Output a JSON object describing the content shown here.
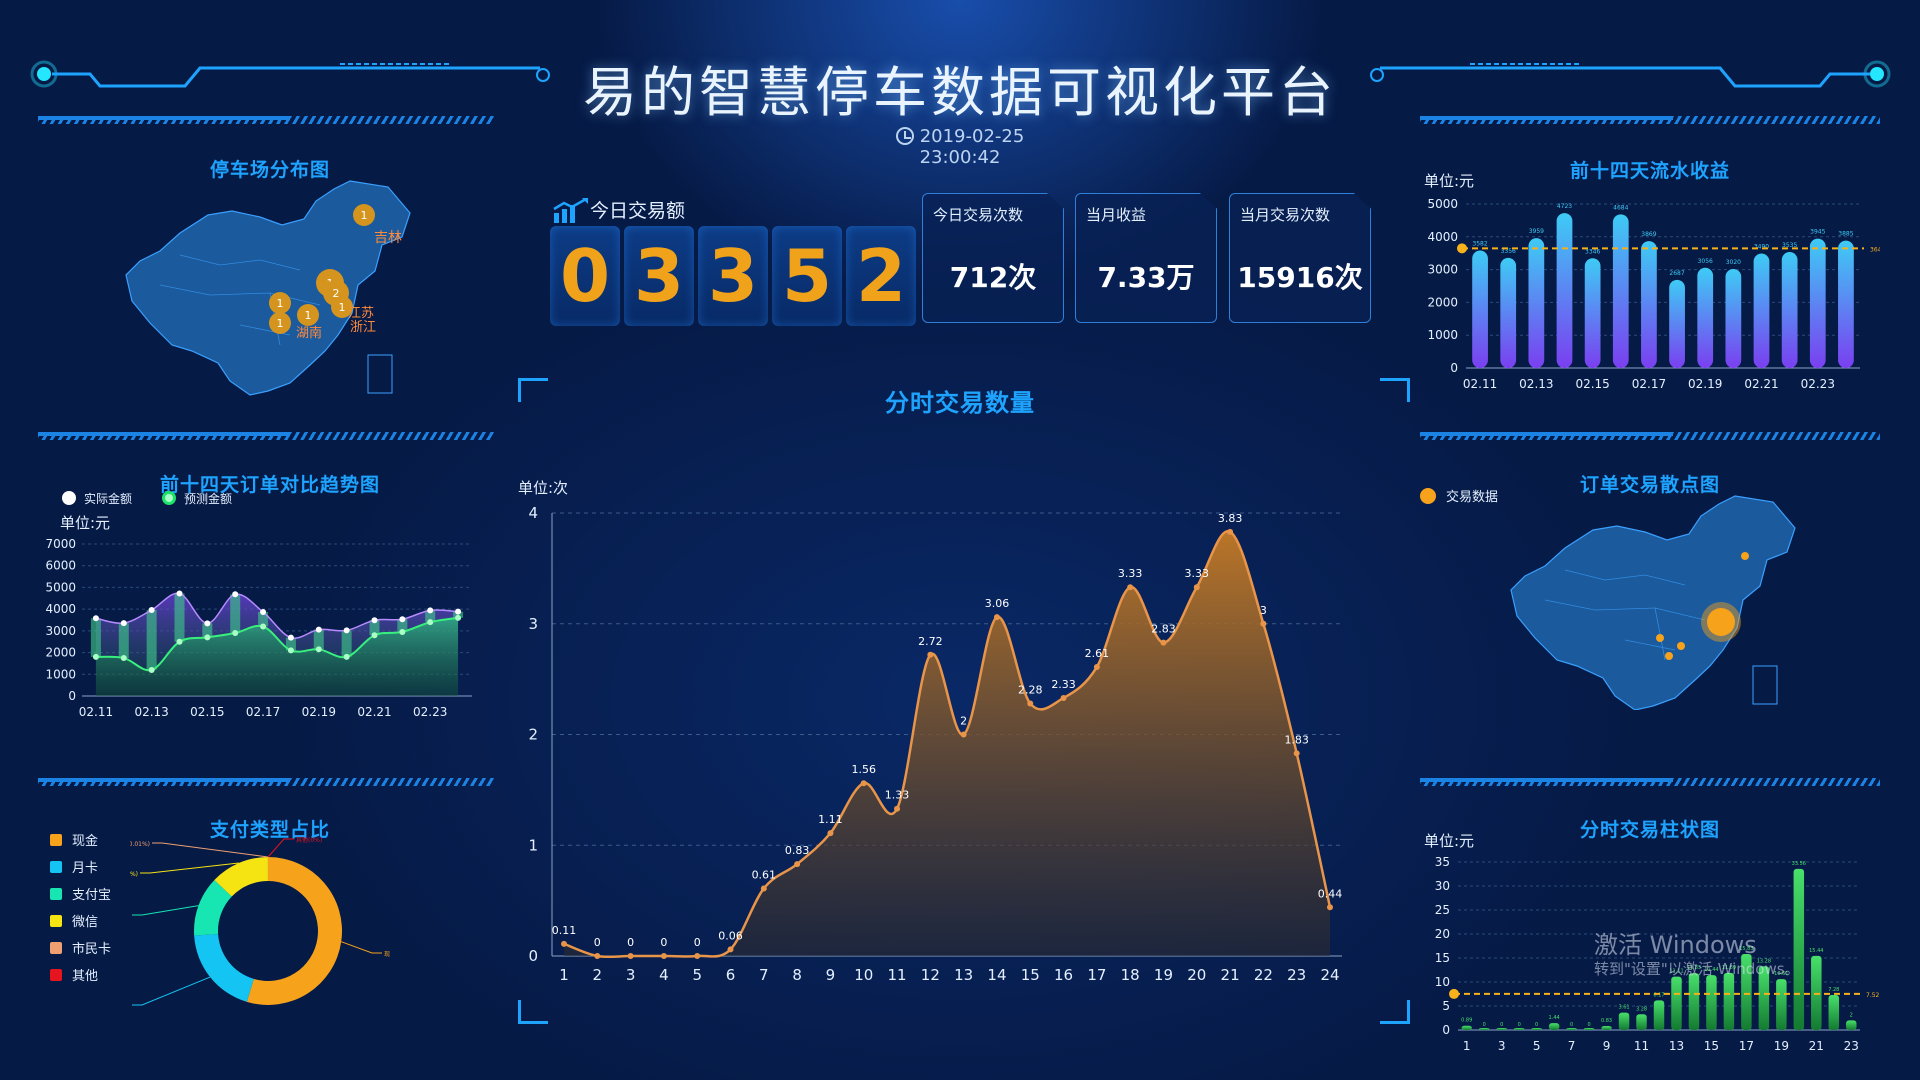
{
  "header": {
    "title": "易的智慧停车数据可视化平台",
    "datetime": "2019-02-25 23:00:42"
  },
  "kpi": {
    "today_amount_label": "今日交易额",
    "today_amount_digits": [
      "0",
      "3",
      "3",
      "5",
      "2"
    ],
    "cards": [
      {
        "label": "今日交易次数",
        "value": "712次"
      },
      {
        "label": "当月收益",
        "value": "7.33万"
      },
      {
        "label": "当月交易次数",
        "value": "15916次"
      }
    ]
  },
  "parking_map": {
    "title": "停车场分布图",
    "labels": [
      "吉林",
      "江苏",
      "浙江",
      "湖南"
    ],
    "markers": [
      "1",
      "1",
      "2",
      "1",
      "1",
      "1",
      "1"
    ]
  },
  "order_trend": {
    "title": "前十四天订单对比趋势图",
    "legend": [
      "实际金额",
      "预测金额"
    ],
    "unit": "单位:元",
    "yticks": [
      "0",
      "1000",
      "2000",
      "3000",
      "4000",
      "5000",
      "6000",
      "7000"
    ],
    "xticks": [
      "02.11",
      "02.13",
      "02.15",
      "02.17",
      "02.19",
      "02.21",
      "02.23"
    ]
  },
  "payment": {
    "title": "支付类型占比",
    "legend": [
      "现金",
      "月卡",
      "支付宝",
      "微信",
      "市民卡",
      "其他"
    ],
    "colors": [
      "#f7a21b",
      "#14c4f2",
      "#17e5b2",
      "#f5e312",
      "#f0a070",
      "#e6141e"
    ],
    "slice_labels": [
      "现金(54.61%)",
      "月卡(19.41%)",
      "支付宝(13.08%)",
      "微信(12.89%)",
      "市民卡(0.01%)",
      "其他(0%)"
    ]
  },
  "hourly": {
    "title": "分时交易数量",
    "unit": "单位:次",
    "yticks": [
      "0",
      "1",
      "2",
      "3",
      "4"
    ],
    "xticks": [
      "1",
      "2",
      "3",
      "4",
      "5",
      "6",
      "7",
      "8",
      "9",
      "10",
      "11",
      "12",
      "13",
      "14",
      "15",
      "16",
      "17",
      "18",
      "19",
      "20",
      "21",
      "22",
      "23",
      "24"
    ],
    "value_labels": [
      "0.11",
      "0",
      "0",
      "0",
      "0",
      "0.06",
      "0.61",
      "0.83",
      "1.11",
      "1.56",
      "1.33",
      "2.72",
      "2",
      "3.06",
      "2.28",
      "2.33",
      "2.61",
      "3.33",
      "2.83",
      "3.33",
      "3.83",
      "3",
      "1.83",
      "0.44"
    ]
  },
  "revenue14": {
    "title": "前十四天流水收益",
    "unit": "单位:元",
    "yticks": [
      "0",
      "1000",
      "2000",
      "3000",
      "4000",
      "5000"
    ],
    "xticks": [
      "02.11",
      "02.13",
      "02.15",
      "02.17",
      "02.19",
      "02.21",
      "02.23"
    ],
    "value_labels": [
      "3582",
      "3356",
      "3959",
      "4723",
      "3346",
      "4684",
      "3869",
      "2687",
      "3056",
      "3020",
      "3490",
      "3535",
      "3945",
      "3885"
    ],
    "avg_label": "3648.5"
  },
  "scatter": {
    "title": "订单交易散点图",
    "legend": "交易数据"
  },
  "hourly_bar": {
    "title": "分时交易柱状图",
    "unit": "单位:元",
    "yticks": [
      "0",
      "5",
      "10",
      "15",
      "20",
      "25",
      "30",
      "35"
    ],
    "xticks": [
      "1",
      "3",
      "5",
      "7",
      "9",
      "11",
      "13",
      "15",
      "17",
      "19",
      "21",
      "23"
    ],
    "value_labels": [
      "0.89",
      "0",
      "0",
      "0",
      "0",
      "1.44",
      "0",
      "0",
      "0.83",
      "3.61",
      "3.28",
      "6.17",
      "11.11",
      "11.83",
      "11.44",
      "11.89",
      "15.83",
      "13.28",
      "10.61",
      "33.56",
      "15.44",
      "7.28",
      "2"
    ],
    "avg_label": "7.52"
  },
  "watermark": {
    "line1": "激活 Windows",
    "line2": "转到\"设置\"以激活 Windows。"
  },
  "chart_data": [
    {
      "type": "line",
      "title": "分时交易数量",
      "ylabel": "单位:次",
      "x": [
        1,
        2,
        3,
        4,
        5,
        6,
        7,
        8,
        9,
        10,
        11,
        12,
        13,
        14,
        15,
        16,
        17,
        18,
        19,
        20,
        21,
        22,
        23,
        24
      ],
      "series": [
        {
          "values": [
            0.11,
            0,
            0,
            0,
            0,
            0.06,
            0.61,
            0.83,
            1.11,
            1.56,
            1.33,
            2.72,
            2,
            3.06,
            2.28,
            2.33,
            2.61,
            3.33,
            2.83,
            3.33,
            3.83,
            3,
            1.83,
            0.44
          ]
        }
      ],
      "ylim": [
        0,
        4
      ]
    },
    {
      "type": "bar",
      "title": "前十四天流水收益",
      "ylabel": "单位:元",
      "categories": [
        "02.11",
        "02.12",
        "02.13",
        "02.14",
        "02.15",
        "02.16",
        "02.17",
        "02.18",
        "02.19",
        "02.20",
        "02.21",
        "02.22",
        "02.23",
        "02.24"
      ],
      "values": [
        3582,
        3356,
        3959,
        4723,
        3346,
        4684,
        3869,
        2687,
        3056,
        3020,
        3490,
        3535,
        3945,
        3885
      ],
      "ylim": [
        0,
        5000
      ],
      "average": 3648.5
    },
    {
      "type": "bar",
      "title": "分时交易柱状图",
      "ylabel": "单位:元",
      "categories": [
        "1",
        "2",
        "3",
        "4",
        "5",
        "6",
        "7",
        "8",
        "9",
        "10",
        "11",
        "12",
        "13",
        "14",
        "15",
        "16",
        "17",
        "18",
        "19",
        "20",
        "21",
        "22",
        "23"
      ],
      "values": [
        0.89,
        0,
        0,
        0,
        0,
        1.44,
        0,
        0,
        0.83,
        3.61,
        3.28,
        6.17,
        11.11,
        11.83,
        11.44,
        11.89,
        15.83,
        13.28,
        10.61,
        33.56,
        15.44,
        7.28,
        2
      ],
      "ylim": [
        0,
        35
      ],
      "average": 7.52
    },
    {
      "type": "area",
      "title": "前十四天订单对比趋势图",
      "ylabel": "单位:元",
      "categories": [
        "02.11",
        "02.12",
        "02.13",
        "02.14",
        "02.15",
        "02.16",
        "02.17",
        "02.18",
        "02.19",
        "02.20",
        "02.21",
        "02.22",
        "02.23",
        "02.24"
      ],
      "series": [
        {
          "name": "实际金额",
          "values": [
            3582,
            3356,
            3959,
            4723,
            3346,
            4684,
            3869,
            2687,
            3056,
            3020,
            3490,
            3535,
            3945,
            3885
          ]
        },
        {
          "name": "预测金额",
          "values": [
            1800,
            1750,
            1200,
            2500,
            2700,
            2900,
            3200,
            2100,
            2150,
            1800,
            2800,
            2950,
            3400,
            3600
          ]
        }
      ],
      "ylim": [
        0,
        7000
      ]
    },
    {
      "type": "pie",
      "title": "支付类型占比",
      "categories": [
        "现金",
        "月卡",
        "支付宝",
        "微信",
        "市民卡",
        "其他"
      ],
      "values": [
        54.61,
        19.41,
        13.08,
        12.89,
        0.01,
        0
      ]
    }
  ]
}
